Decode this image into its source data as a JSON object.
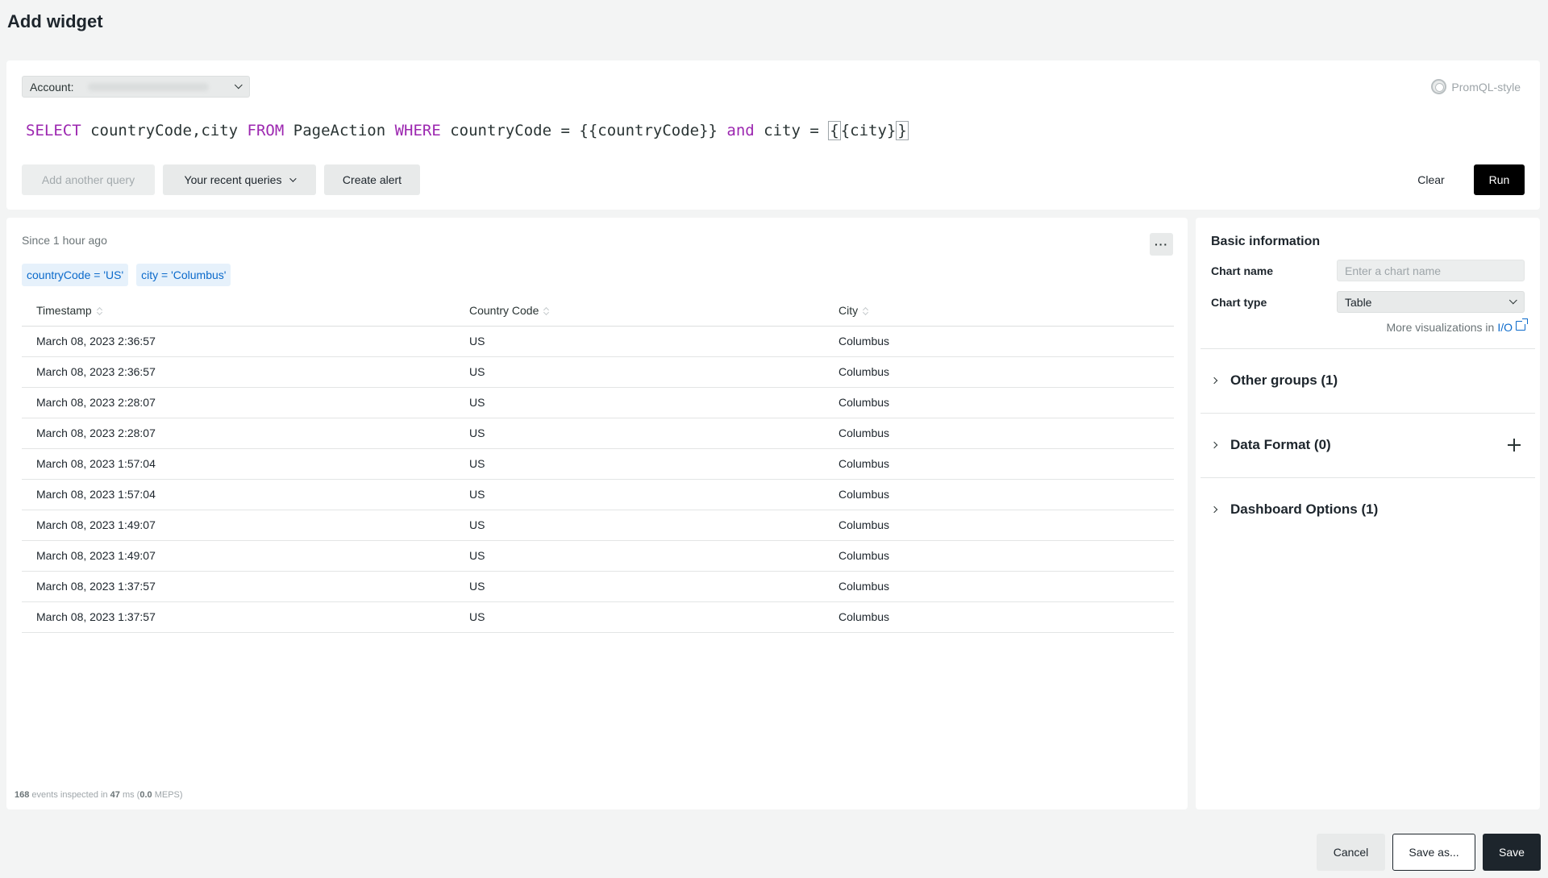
{
  "page": {
    "title": "Add widget"
  },
  "query": {
    "account_label": "Account:",
    "promql_label": "PromQL-style",
    "text": {
      "t1": "SELECT",
      "t2": " countryCode,city ",
      "t3": "FROM",
      "t4": " PageAction ",
      "t5": "WHERE",
      "t6": " countryCode = {{countryCode}} ",
      "t7": "and",
      "t8": " city = ",
      "t9": "{",
      "t10": "{city}",
      "t11": "}"
    },
    "add_another_label": "Add another query",
    "recent_label": "Your recent queries",
    "create_alert_label": "Create alert",
    "clear_label": "Clear",
    "run_label": "Run"
  },
  "results": {
    "since_label": "Since 1 hour ago",
    "more_label": "···",
    "filters": [
      "countryCode = 'US'",
      "city = 'Columbus'"
    ],
    "columns": [
      "Timestamp",
      "Country Code",
      "City"
    ],
    "rows": [
      [
        "March 08, 2023 2:36:57",
        "US",
        "Columbus"
      ],
      [
        "March 08, 2023 2:36:57",
        "US",
        "Columbus"
      ],
      [
        "March 08, 2023 2:28:07",
        "US",
        "Columbus"
      ],
      [
        "March 08, 2023 2:28:07",
        "US",
        "Columbus"
      ],
      [
        "March 08, 2023 1:57:04",
        "US",
        "Columbus"
      ],
      [
        "March 08, 2023 1:57:04",
        "US",
        "Columbus"
      ],
      [
        "March 08, 2023 1:49:07",
        "US",
        "Columbus"
      ],
      [
        "March 08, 2023 1:49:07",
        "US",
        "Columbus"
      ],
      [
        "March 08, 2023 1:37:57",
        "US",
        "Columbus"
      ],
      [
        "March 08, 2023 1:37:57",
        "US",
        "Columbus"
      ]
    ],
    "inspect": {
      "events": "168",
      "events_text": " events inspected in ",
      "ms": "47",
      "ms_text": " ms (",
      "meps": "0.0",
      "meps_text": " MEPS)"
    }
  },
  "settings": {
    "basic_title": "Basic information",
    "chart_name_label": "Chart name",
    "chart_name_placeholder": "Enter a chart name",
    "chart_type_label": "Chart type",
    "chart_type_value": "Table",
    "more_vis_text": "More visualizations in",
    "more_vis_link": "I/O",
    "groups": [
      {
        "label": "Other groups (1)"
      },
      {
        "label": "Data Format (0)"
      },
      {
        "label": "Dashboard Options (1)"
      }
    ]
  },
  "footer": {
    "cancel_label": "Cancel",
    "save_as_label": "Save as...",
    "save_label": "Save"
  }
}
